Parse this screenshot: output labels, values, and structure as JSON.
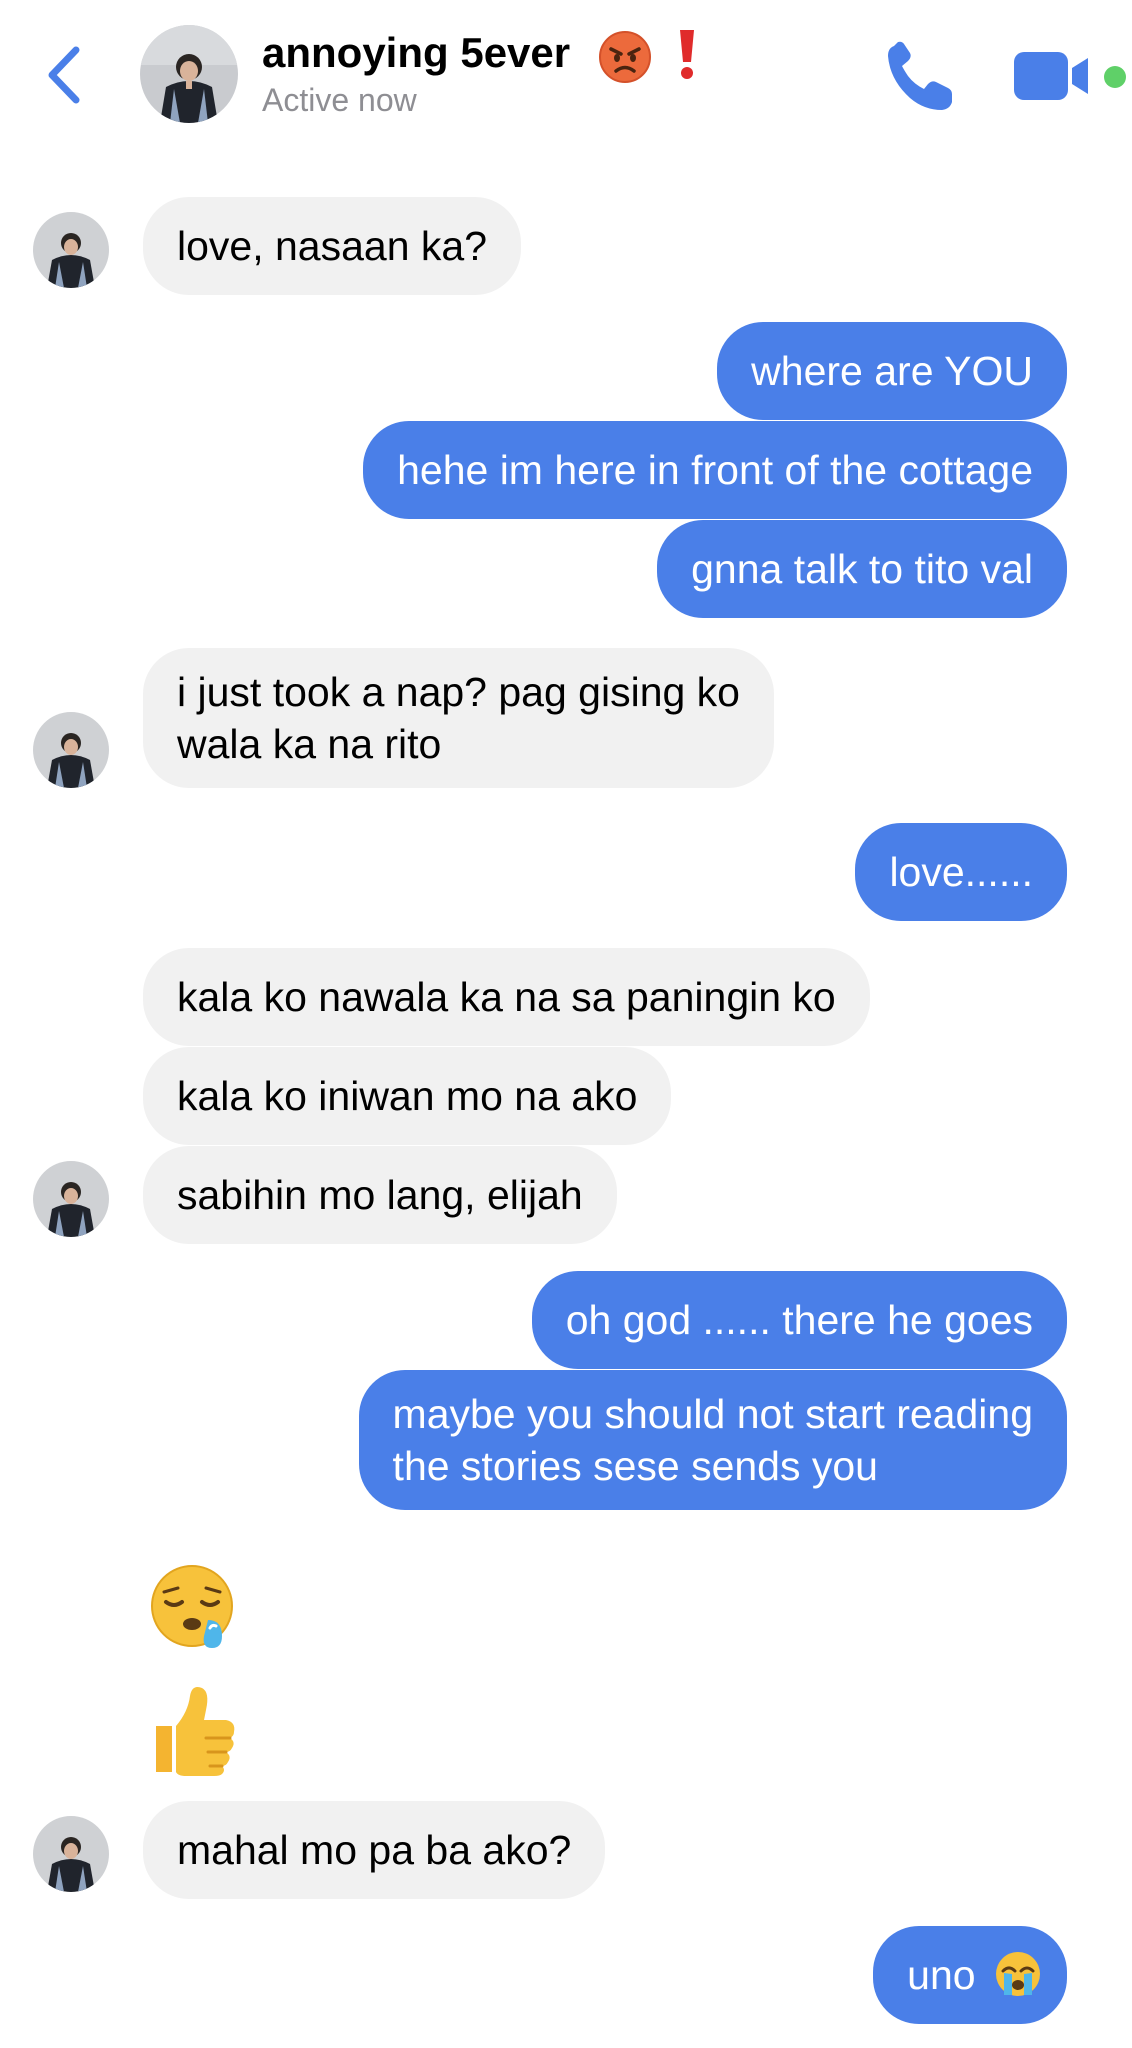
{
  "header": {
    "contact_name": "annoying 5ever",
    "status": "Active now",
    "back_icon": "chevron-left-icon",
    "call_icon": "phone-icon",
    "video_icon": "video-camera-icon",
    "accent_color": "#4a7fe8",
    "online_color": "#5fd068"
  },
  "messages": [
    {
      "from": "them",
      "text": "love, nasaan ka?"
    },
    {
      "from": "me",
      "text": "where are YOU"
    },
    {
      "from": "me",
      "text": "hehe im here in front of the cottage"
    },
    {
      "from": "me",
      "text": "gnna talk to tito val"
    },
    {
      "from": "them",
      "line1": "i just took a nap? pag gising ko",
      "line2": "wala ka na rito"
    },
    {
      "from": "me",
      "text": "love......"
    },
    {
      "from": "them",
      "text": "kala ko nawala ka na sa paningin ko"
    },
    {
      "from": "them",
      "text": "kala ko iniwan mo na ako"
    },
    {
      "from": "them",
      "text": "sabihin mo lang, elijah"
    },
    {
      "from": "me",
      "text": "oh god ...... there he goes"
    },
    {
      "from": "me",
      "line1": "maybe you should not start reading",
      "line2": "the stories sese sends you"
    },
    {
      "from": "them",
      "emoji": "sleepy-face-emoji"
    },
    {
      "from": "them",
      "emoji": "thumbs-up-emoji"
    },
    {
      "from": "them",
      "text": "mahal mo pa ba ako?"
    },
    {
      "from": "me",
      "text": "uno",
      "emoji": "loudly-crying-face-emoji"
    }
  ],
  "colors": {
    "incoming_bubble": "#f1f1f1",
    "outgoing_bubble": "#4a7fe8"
  }
}
